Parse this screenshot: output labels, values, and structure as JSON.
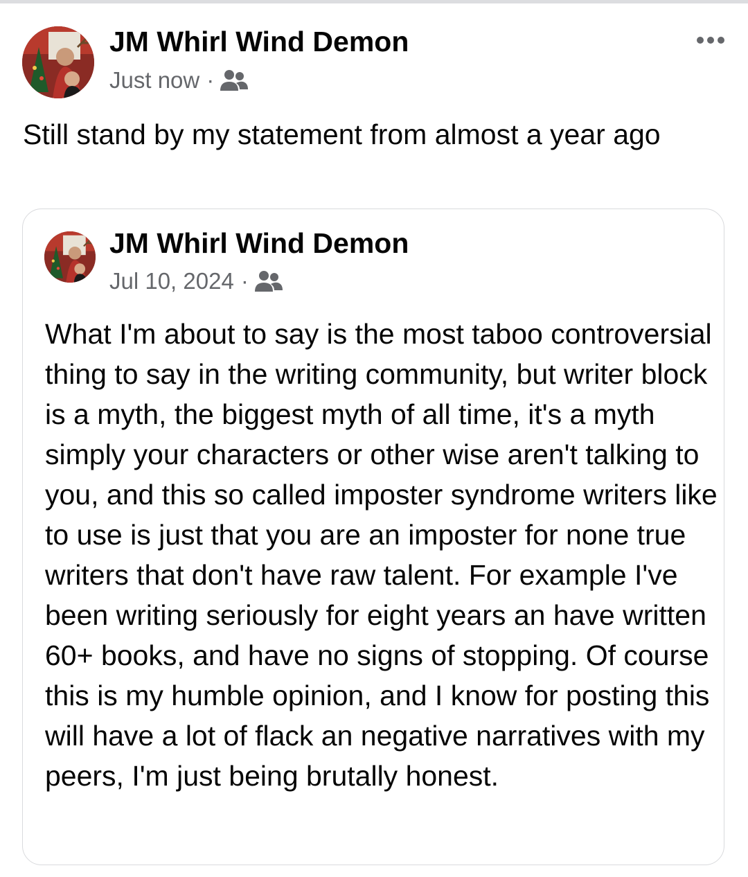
{
  "post": {
    "author": "JM Whirl Wind Demon",
    "timestamp": "Just now",
    "separator": "·",
    "audience_icon": "friends-icon",
    "more_icon": "more-horizontal-icon",
    "text": "Still stand by my statement from almost a year ago"
  },
  "shared_post": {
    "author": "JM Whirl Wind Demon",
    "timestamp": "Jul 10, 2024",
    "separator": "·",
    "audience_icon": "friends-icon",
    "text": "What I'm about to say is the most taboo controversial thing to say in the writing community, but writer block is a myth, the biggest myth of all time, it's a myth simply your characters or other wise aren't talking to you, and this so called imposter syndrome writers like to use is just that you are an imposter for none true writers that don't have raw talent. For example I've been writing seriously for eight years an have written 60+ books, and have no signs of stopping. Of course this is my humble opinion, and I know for posting this will have a lot of flack an negative narratives with my peers, I'm just being brutally honest."
  },
  "colors": {
    "text_primary": "#050505",
    "text_secondary": "#65676b",
    "card_border": "#d9dadd"
  }
}
